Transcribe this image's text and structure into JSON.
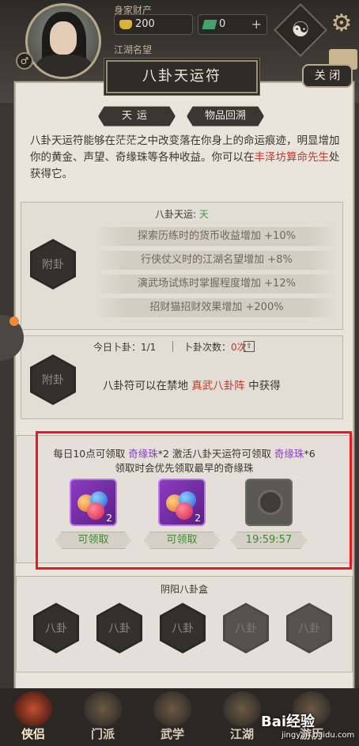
{
  "header": {
    "wealth_label": "身家财产",
    "gold_value": "200",
    "jade_value": "0",
    "plus": "+",
    "fame_label": "江湖名望",
    "gender_symbol": "♂"
  },
  "dialog": {
    "title": "八卦天运符",
    "close_label": "关 闭",
    "tabs": [
      {
        "label": "天运"
      },
      {
        "label": "物品回溯"
      }
    ],
    "description_1": "八卦天运符能够在茫茫之中改变落在你身上的命运痕迹，明显增加你的黄金、声望、奇缘珠等各种收益。你可以在",
    "description_place": "丰泽坊算命先生",
    "description_2": "处获得它。"
  },
  "bagua_fortune": {
    "heading_prefix": "八卦天运: ",
    "heading_value": "天",
    "slot_label": "附卦",
    "effects": [
      "探索历练时的货币收益增加 +10%",
      "行侠仗义时的江湖名望增加 +8%",
      "演武场试炼时掌握程度增加 +12%",
      "招财猫招财效果增加 +200%"
    ]
  },
  "divination": {
    "today_label": "今日卜卦：1/1",
    "count_label": "卜卦次数：",
    "count_value": "0次",
    "slot_label": "附卦",
    "source_prefix": "八卦符可以在禁地 ",
    "source_place": "真武八卦阵",
    "source_suffix": " 中获得"
  },
  "claim": {
    "line1_a": "每日10点可领取 ",
    "line1_item": "奇缘珠",
    "line1_b": "*2 激活八卦天运符可领取 ",
    "line1_item2": "奇缘珠",
    "line1_c": "*6",
    "line2": "领取时会优先领取最早的奇缘珠",
    "items": [
      {
        "count": "2",
        "status": "可领取"
      },
      {
        "count": "2",
        "status": "可领取"
      },
      {
        "count": "",
        "status": "19:59:57"
      }
    ],
    "status_color": "#3d8a2c"
  },
  "yinyang_box": {
    "heading": "阴阳八卦盒",
    "slots": [
      "八卦",
      "八卦",
      "八卦",
      "八卦",
      "八卦"
    ]
  },
  "bottom_nav": [
    {
      "label": "侠侣"
    },
    {
      "label": "门派"
    },
    {
      "label": "武学"
    },
    {
      "label": "江湖"
    },
    {
      "label": "游历"
    }
  ],
  "watermark": {
    "brand": "Bai经验",
    "url": "jingyan.baidu.com"
  },
  "colors": {
    "highlight_frame": "#e51b24",
    "red_text": "#c03a2b",
    "purple_text": "#8a3ec2",
    "green_text": "#4a9a3a"
  }
}
